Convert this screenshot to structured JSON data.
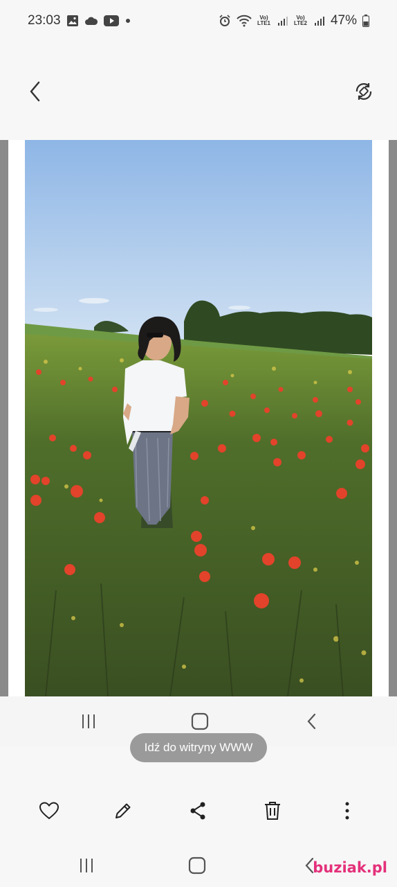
{
  "status_bar": {
    "time": "23:03",
    "battery": "47%",
    "lte1": "LTE1",
    "lte2": "LTE2",
    "vo": "Vo)",
    "notification_icons": [
      "image-icon",
      "cloud-icon",
      "youtube-icon",
      "dot-icon"
    ],
    "system_icons": [
      "alarm-icon",
      "wifi-icon",
      "signal-icon",
      "battery-icon"
    ]
  },
  "toolbar": {
    "back_icon": "chevron-left-icon",
    "rotate_icon": "rotate-screen-icon"
  },
  "photo": {
    "subject": "woman-in-poppy-field"
  },
  "overlay": {
    "web_button_label": "Idź do witryny WWW"
  },
  "actions": {
    "items": [
      "heart-icon",
      "pencil-icon",
      "share-icon",
      "trash-icon",
      "more-vertical-icon"
    ]
  },
  "watermark": {
    "text": "buziak.pl"
  },
  "colors": {
    "sky": "#a8c8ee",
    "field": "#4a6b2a",
    "poppy": "#e2432a",
    "pill": "#9a9a9a",
    "watermark": "#e4307a"
  }
}
